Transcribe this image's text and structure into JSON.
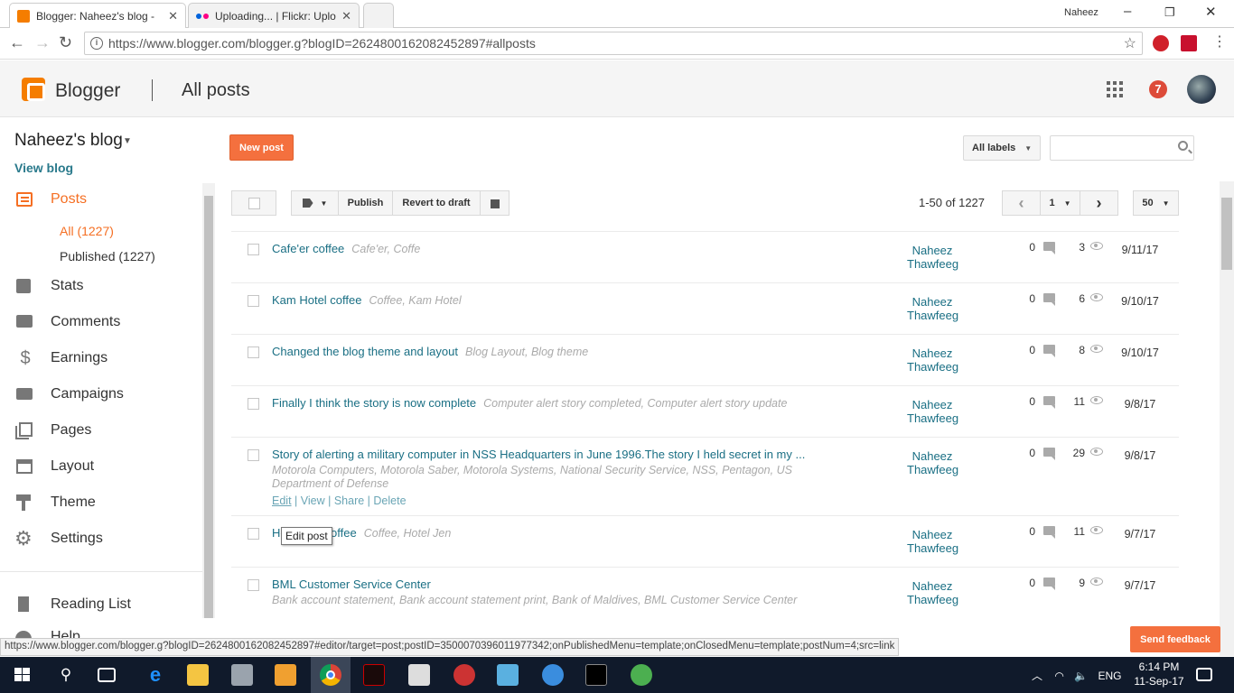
{
  "browser": {
    "tabs": [
      {
        "title": "Blogger: Naheez's blog - ",
        "active": true
      },
      {
        "title": "Uploading... | Flickr: Uplo",
        "active": false
      },
      {
        "title": "",
        "active": false
      }
    ],
    "window_user": "Naheez",
    "url": "https://www.blogger.com/blogger.g?blogID=2624800162082452897#allposts",
    "status_url": "https://www.blogger.com/blogger.g?blogID=2624800162082452897#editor/target=post;postID=3500070396011977342;onPublishedMenu=template;onClosedMenu=template;postNum=4;src=link"
  },
  "header": {
    "brand": "Blogger",
    "page_title": "All posts",
    "notification_count": "7"
  },
  "sidebar": {
    "blog_name": "Naheez's blog",
    "view_blog": "View blog",
    "posts_label": "Posts",
    "sub_all": "All (1227)",
    "sub_published": "Published (1227)",
    "items": [
      {
        "label": "Stats",
        "icon": "stats-icon"
      },
      {
        "label": "Comments",
        "icon": "comments-icon"
      },
      {
        "label": "Earnings",
        "icon": "earnings-icon"
      },
      {
        "label": "Campaigns",
        "icon": "campaigns-icon"
      },
      {
        "label": "Pages",
        "icon": "pages-icon"
      },
      {
        "label": "Layout",
        "icon": "layout-icon"
      },
      {
        "label": "Theme",
        "icon": "theme-icon"
      },
      {
        "label": "Settings",
        "icon": "settings-icon"
      }
    ],
    "reading_list": "Reading List",
    "help_partial": "Help"
  },
  "toolbar": {
    "new_post": "New post",
    "all_labels": "All labels",
    "publish": "Publish",
    "revert": "Revert to draft",
    "range": "1-50 of 1227",
    "page": "1",
    "per_page": "50"
  },
  "posts": [
    {
      "title": "Cafe'er coffee",
      "labels": "Cafe'er, Coffe",
      "author1": "Naheez",
      "author2": "Thawfeeg",
      "comments": "0",
      "views": "3",
      "date": "9/11/17"
    },
    {
      "title": "Kam Hotel coffee",
      "labels": "Coffee, Kam Hotel",
      "author1": "Naheez",
      "author2": "Thawfeeg",
      "comments": "0",
      "views": "6",
      "date": "9/10/17"
    },
    {
      "title": "Changed the blog theme and layout",
      "labels": "Blog Layout, Blog theme",
      "author1": "Naheez",
      "author2": "Thawfeeg",
      "comments": "0",
      "views": "8",
      "date": "9/10/17"
    },
    {
      "title": "Finally I think the story is now complete",
      "labels": "Computer alert story completed, Computer alert story update",
      "author1": "Naheez",
      "author2": "Thawfeeg",
      "comments": "0",
      "views": "11",
      "date": "9/8/17"
    },
    {
      "title": "Story of alerting a military computer in NSS Headquarters in June 1996.The story I held secret in my ...",
      "labels": "Motorola Computers, Motorola Saber, Motorola Systems, National Security Service, NSS, Pentagon, US Department of Defense",
      "author1": "Naheez",
      "author2": "Thawfeeg",
      "comments": "0",
      "views": "29",
      "date": "9/8/17",
      "actions": {
        "edit": "Edit",
        "view": "View",
        "share": "Share",
        "delete": "Delete"
      }
    },
    {
      "title": "Hotel Jen coffee",
      "labels": "Coffee, Hotel Jen",
      "author1": "Naheez",
      "author2": "Thawfeeg",
      "comments": "0",
      "views": "11",
      "date": "9/7/17"
    },
    {
      "title": "BML Customer Service Center",
      "labels": "Bank account statement, Bank account statement print, Bank of Maldives, BML Customer Service Center",
      "author1": "Naheez",
      "author2": "Thawfeeg",
      "comments": "0",
      "views": "9",
      "date": "9/7/17"
    }
  ],
  "tooltip": "Edit post",
  "feedback": "Send feedback",
  "taskbar": {
    "lang": "ENG",
    "time": "6:14 PM",
    "date": "11-Sep-17"
  },
  "colors": {
    "accent": "#f4703e",
    "link": "#1a6f84",
    "taskbar": "#101a2b"
  }
}
